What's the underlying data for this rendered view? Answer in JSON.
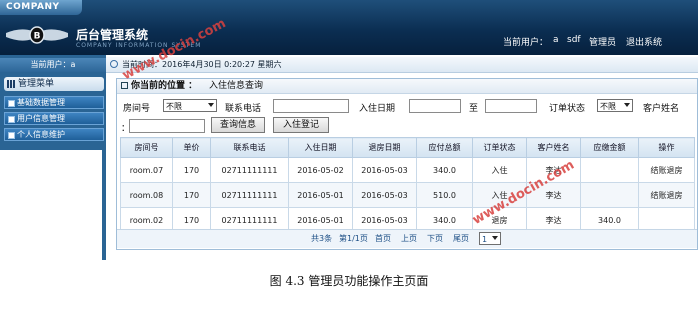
{
  "header": {
    "company": "COMPANY",
    "title": "后台管理系统",
    "subtitle": "COMPANY INFORMATION SYSTEM",
    "current_user_label": "当前用户：",
    "current_user": "a",
    "user_name": "sdf",
    "role": "管理员",
    "logout": "退出系统"
  },
  "timebar": {
    "text": "当前时间：2016年4月30日  0:20:27  星期六"
  },
  "sidebar": {
    "user": "当前用户：a",
    "menu_title": "管理菜单",
    "items": [
      {
        "label": "基础数据管理"
      },
      {
        "label": "用户信息管理"
      },
      {
        "label": "个人信息维护"
      }
    ]
  },
  "location": {
    "label": "你当前的位置  ：",
    "crumb": "入住信息查询"
  },
  "filters": {
    "room_label": "房间号",
    "room_value": "不限",
    "phone_label": "联系电话",
    "checkin_label": "入住日期",
    "to_label": "至",
    "status_label": "订单状态",
    "status_value": "不限",
    "name_label": "客户姓名",
    "name_colon": "：",
    "query_button": "查询信息",
    "register_button": "入住登记"
  },
  "table": {
    "headers": [
      "房间号",
      "单价",
      "联系电话",
      "入住日期",
      "退房日期",
      "应付总额",
      "订单状态",
      "客户姓名",
      "应缴金额",
      "操作"
    ],
    "rows": [
      [
        "room.07",
        "170",
        "02711111111",
        "2016-05-02",
        "2016-05-03",
        "340.0",
        "入住",
        "李达",
        "",
        "结账退房"
      ],
      [
        "room.08",
        "170",
        "02711111111",
        "2016-05-01",
        "2016-05-03",
        "510.0",
        "入住",
        "李达",
        "",
        "结账退房"
      ],
      [
        "room.02",
        "170",
        "02711111111",
        "2016-05-01",
        "2016-05-03",
        "340.0",
        "退房",
        "李达",
        "340.0",
        ""
      ]
    ]
  },
  "pager": {
    "total": "共3条",
    "page": "第1/1页",
    "first": "首页",
    "prev": "上页",
    "next": "下页",
    "last": "尾页",
    "select": "1"
  },
  "watermark": "www.docin.com",
  "caption": "图 4.3 管理员功能操作主页面"
}
